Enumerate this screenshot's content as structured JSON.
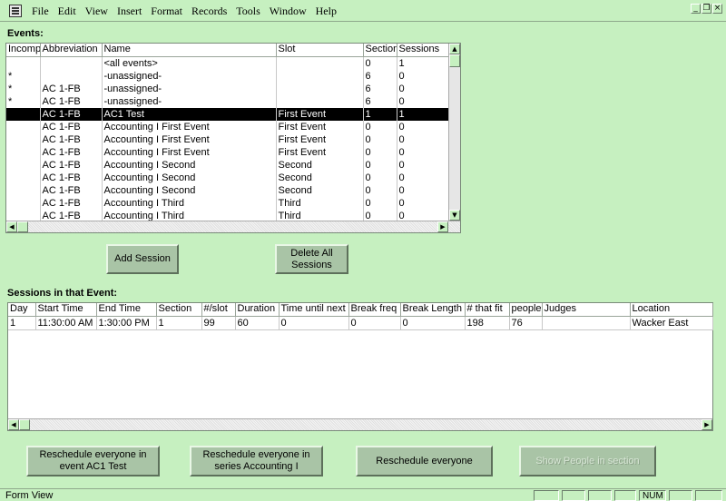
{
  "menubar": {
    "items": [
      "File",
      "Edit",
      "View",
      "Insert",
      "Format",
      "Records",
      "Tools",
      "Window",
      "Help"
    ]
  },
  "events": {
    "label": "Events:",
    "columns": [
      "Incomp",
      "Abbreviation",
      "Name",
      "Slot",
      "Section",
      "Sessions"
    ],
    "rows": [
      [
        "",
        "",
        "<all events>",
        "",
        "0",
        "1"
      ],
      [
        "*",
        "",
        "-unassigned-",
        "",
        "6",
        "0"
      ],
      [
        "*",
        "AC 1-FB",
        "-unassigned-",
        "",
        "6",
        "0"
      ],
      [
        "*",
        "AC 1-FB",
        "-unassigned-",
        "",
        "6",
        "0"
      ],
      [
        "",
        "AC 1-FB",
        "AC1 Test",
        "First Event",
        "1",
        "1"
      ],
      [
        "",
        "AC 1-FB",
        "Accounting I First Event",
        "First Event",
        "0",
        "0"
      ],
      [
        "",
        "AC 1-FB",
        "Accounting I First Event",
        "First Event",
        "0",
        "0"
      ],
      [
        "",
        "AC 1-FB",
        "Accounting I First Event",
        "First Event",
        "0",
        "0"
      ],
      [
        "",
        "AC 1-FB",
        "Accounting I Second",
        "Second",
        "0",
        "0"
      ],
      [
        "",
        "AC 1-FB",
        "Accounting I Second",
        "Second",
        "0",
        "0"
      ],
      [
        "",
        "AC 1-FB",
        "Accounting I Second",
        "Second",
        "0",
        "0"
      ],
      [
        "",
        "AC 1-FB",
        "Accounting I Third",
        "Third",
        "0",
        "0"
      ],
      [
        "",
        "AC 1-FB",
        "Accounting I Third",
        "Third",
        "0",
        "0"
      ]
    ],
    "selected_index": 4
  },
  "buttons": {
    "add_session": "Add Session",
    "delete_all_sessions": "Delete All Sessions",
    "reschedule_event": "Reschedule everyone in event AC1 Test",
    "reschedule_series": "Reschedule everyone in series Accounting I",
    "reschedule_everyone": "Reschedule everyone",
    "show_people": "Show People in section"
  },
  "sessions": {
    "label": "Sessions in that Event:",
    "columns": [
      "Day",
      "Start Time",
      "End Time",
      "Section",
      "#/slot",
      "Duration",
      "Time until next",
      "Break freq",
      "Break Length",
      "# that fit",
      "people",
      "Judges",
      "Location"
    ],
    "rows": [
      [
        "1",
        "11:30:00 AM",
        "1:30:00 PM",
        "1",
        "99",
        "60",
        "0",
        "0",
        "0",
        "198",
        "76",
        "",
        "Wacker East"
      ]
    ]
  },
  "statusbar": {
    "text": "Form View",
    "num": "NUM"
  },
  "colors": {
    "background": "#c6f0c0",
    "selected_row": "#000000",
    "button_face": "#a9c4a6"
  }
}
